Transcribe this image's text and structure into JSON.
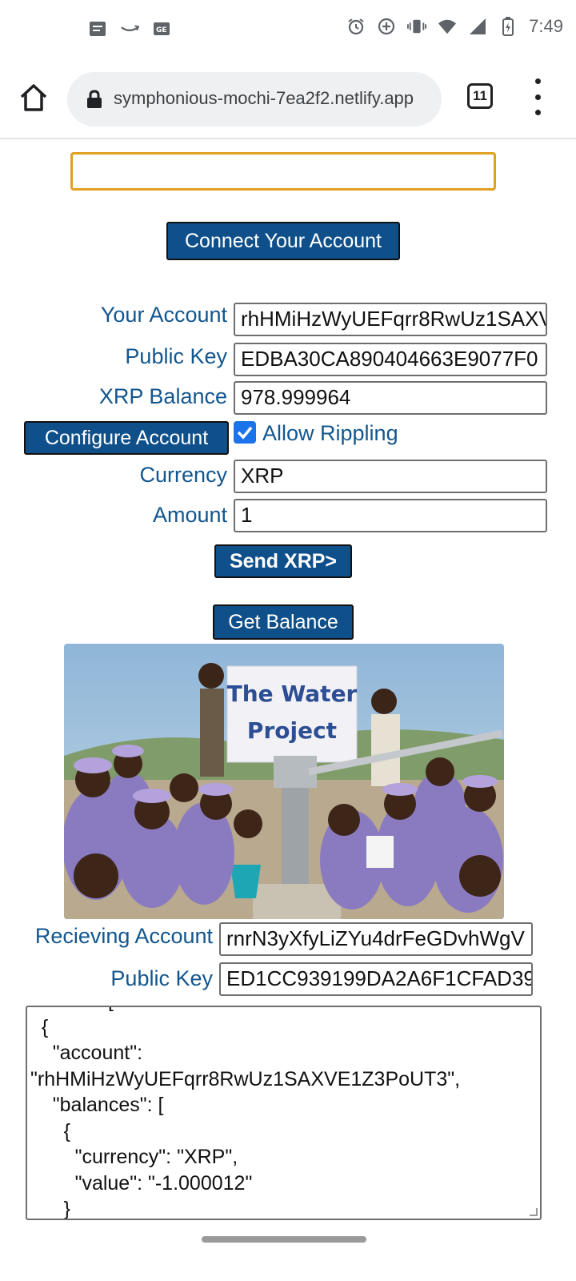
{
  "status_bar": {
    "time": "7:49",
    "icons_left": [
      "notes-icon",
      "amazon-icon",
      "news-icon"
    ],
    "icons_right": [
      "alarm-icon",
      "data-saver-icon",
      "vibrate-icon",
      "wifi-icon",
      "signal-icon",
      "battery-charging-icon"
    ]
  },
  "browser": {
    "url": "symphonious-mochi-7ea2f2.netlify.app",
    "tab_count": "11"
  },
  "page": {
    "top_input_value": "",
    "connect_button": "Connect Your Account",
    "your_account_label": "Your Account",
    "your_account_value": "rhHMiHzWyUEFqrr8RwUz1SAXVE1Z3PoUT3",
    "public_key_label": "Public Key",
    "public_key_value": "EDBA30CA890404663E9077F0",
    "xrp_balance_label": "XRP Balance",
    "xrp_balance_value": "978.999964",
    "configure_button": "Configure Account",
    "allow_rippling_label": "Allow Rippling",
    "allow_rippling_checked": true,
    "currency_label": "Currency",
    "currency_value": "XRP",
    "amount_label": "Amount",
    "amount_value": "1",
    "send_button": "Send XRP>",
    "get_balance_button": "Get Balance",
    "photo_banner_line1": "The Water",
    "photo_banner_line2": "Project",
    "receiving_account_label": "Recieving Account",
    "receiving_account_value": "rnrN3yXfyLiZYu4drFeGDvhWgV",
    "receiving_public_key_label": "Public Key",
    "receiving_public_key_value": "ED1CC939199DA2A6F1CFAD39",
    "output_text": "  \"lines\": [\n  {\n    \"account\":\n\"rhHMiHzWyUEFqrr8RwUz1SAXVE1Z3PoUT3\",\n    \"balances\": [\n      {\n        \"currency\": \"XRP\",\n        \"value\": \"-1.000012\"\n      }"
  }
}
